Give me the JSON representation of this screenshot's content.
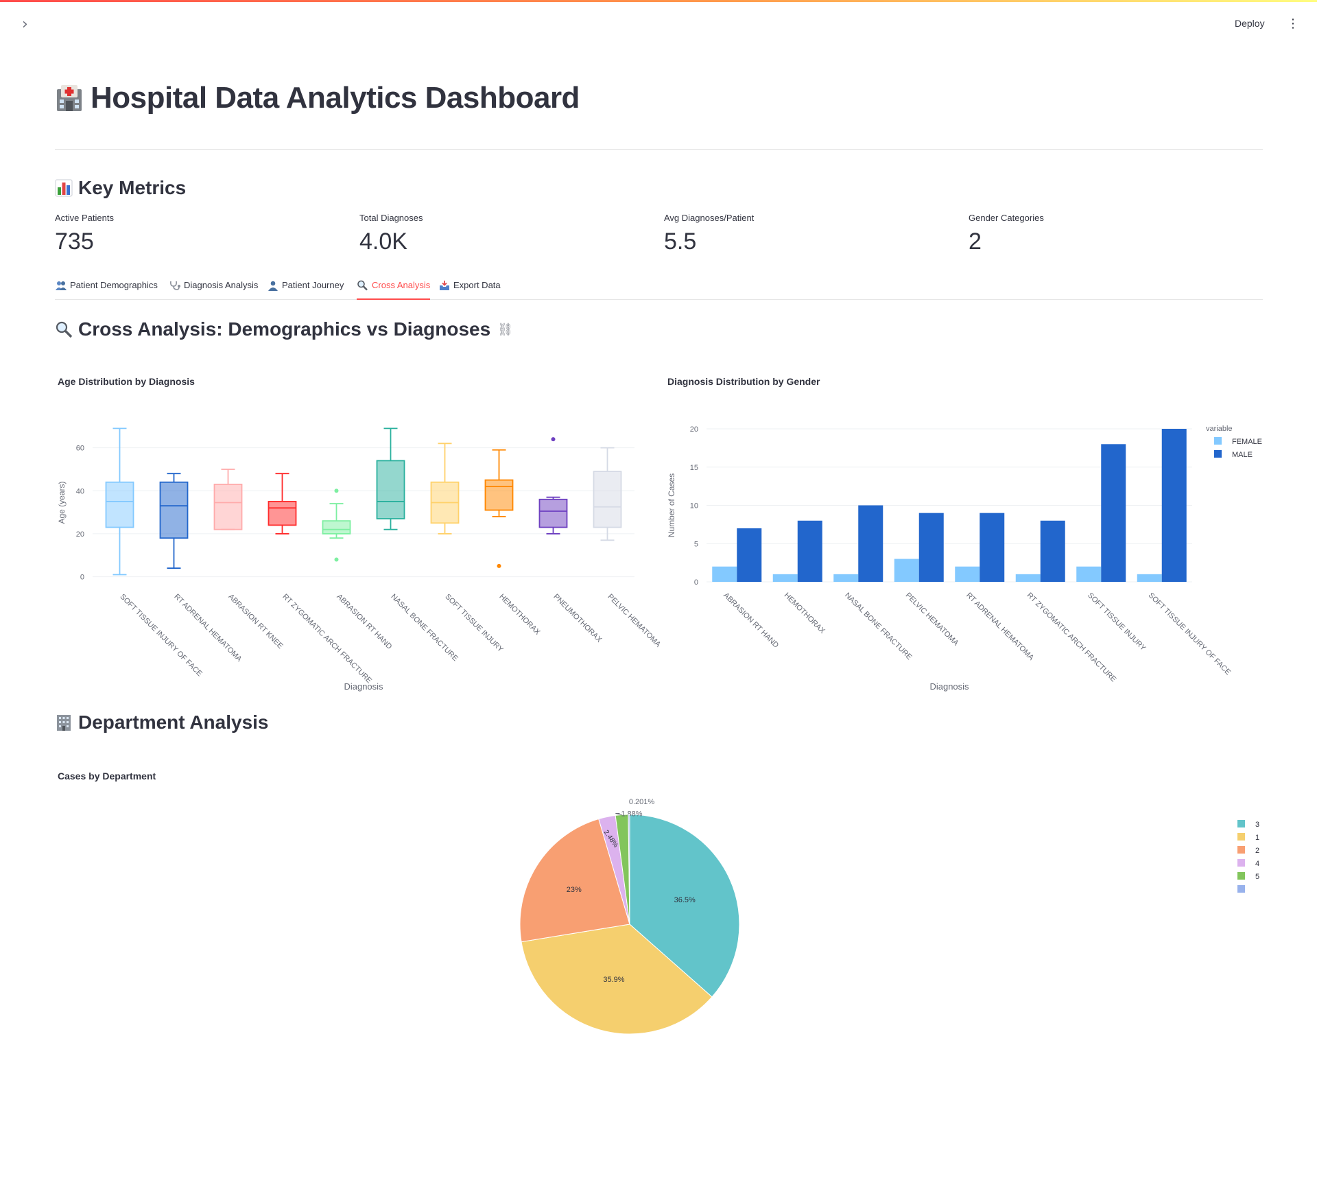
{
  "header": {
    "deploy_label": "Deploy",
    "menu_glyph": "⋮",
    "sidebar_toggle_glyph": "›"
  },
  "page": {
    "title": "Hospital Data Analytics Dashboard",
    "title_icon": "hospital-icon"
  },
  "key_metrics": {
    "heading": "Key Metrics",
    "icon": "bar-chart-icon",
    "items": [
      {
        "label": "Active Patients",
        "value": "735"
      },
      {
        "label": "Total Diagnoses",
        "value": "4.0K"
      },
      {
        "label": "Avg Diagnoses/Patient",
        "value": "5.5"
      },
      {
        "label": "Gender Categories",
        "value": "2"
      }
    ]
  },
  "tabs": [
    {
      "label": "Patient Demographics",
      "icon": "people-icon",
      "active": false
    },
    {
      "label": "Diagnosis Analysis",
      "icon": "stethoscope-icon",
      "active": false
    },
    {
      "label": "Patient Journey",
      "icon": "person-icon",
      "active": false
    },
    {
      "label": "Cross Analysis",
      "icon": "magnifier-icon",
      "active": true
    },
    {
      "label": "Export Data",
      "icon": "inbox-tray-icon",
      "active": false
    }
  ],
  "cross_analysis": {
    "heading": "Cross Analysis: Demographics vs Diagnoses",
    "icon": "magnifier-icon",
    "link_glyph": "⛓"
  },
  "department": {
    "heading": "Department Analysis",
    "icon": "office-building-icon"
  },
  "colors": {
    "accent": "#ff4b4b",
    "female": "#83c9ff",
    "male": "#2266cc"
  },
  "chart_data": [
    {
      "type": "box",
      "title": "Age Distribution by Diagnosis",
      "xlabel": "Diagnosis",
      "ylabel": "Age (years)",
      "ylim": [
        -3,
        72
      ],
      "yticks": [
        0,
        20,
        40,
        60
      ],
      "grid": true,
      "categories": [
        "SOFT TISSUE INJURY OF FACE",
        "RT ADRENAL HEMATOMA",
        "ABRASION RT KNEE",
        "RT ZYGOMATIC ARCH FRACTURE",
        "ABRASION RT HAND",
        "NASAL BONE FRACTURE",
        "SOFT TISSUE INJURY",
        "HEMOTHORAX",
        "PNEUMOTHORAX",
        "PELVIC HEMATOMA"
      ],
      "boxes": [
        {
          "min": 1,
          "q1": 23,
          "median": 35,
          "q3": 44,
          "max": 69,
          "outliers": [],
          "color": "#83c9ff"
        },
        {
          "min": 4,
          "q1": 18,
          "median": 33,
          "q3": 44,
          "max": 48,
          "outliers": [],
          "color": "#2266cc"
        },
        {
          "min": 22,
          "q1": 22,
          "median": 34.5,
          "q3": 43,
          "max": 50,
          "outliers": [],
          "color": "#ffabab"
        },
        {
          "min": 20,
          "q1": 24,
          "median": 32,
          "q3": 35,
          "max": 48,
          "outliers": [],
          "color": "#ff2b2b"
        },
        {
          "min": 18,
          "q1": 20,
          "median": 22,
          "q3": 26,
          "max": 34,
          "outliers": [
            8,
            40
          ],
          "color": "#7defa1"
        },
        {
          "min": 22,
          "q1": 27,
          "median": 35,
          "q3": 54,
          "max": 69,
          "outliers": [],
          "color": "#29b09d"
        },
        {
          "min": 20,
          "q1": 25,
          "median": 34.5,
          "q3": 44,
          "max": 62,
          "outliers": [],
          "color": "#ffd16a"
        },
        {
          "min": 28,
          "q1": 31,
          "median": 42,
          "q3": 45,
          "max": 59,
          "outliers": [
            5
          ],
          "color": "#ff8700"
        },
        {
          "min": 20,
          "q1": 23,
          "median": 30.5,
          "q3": 36,
          "max": 37,
          "outliers": [
            64
          ],
          "color": "#6d3fc0"
        },
        {
          "min": 17,
          "q1": 23,
          "median": 32.5,
          "q3": 49,
          "max": 60,
          "outliers": [],
          "color": "#d5dae5"
        }
      ]
    },
    {
      "type": "bar",
      "title": "Diagnosis Distribution by Gender",
      "xlabel": "Diagnosis",
      "ylabel": "Number of Cases",
      "ylim": [
        0,
        20
      ],
      "yticks": [
        0,
        5,
        10,
        15,
        20
      ],
      "legend_title": "variable",
      "legend_position": "top-right",
      "categories": [
        "ABRASION RT HAND",
        "HEMOTHORAX",
        "NASAL BONE FRACTURE",
        "PELVIC HEMATOMA",
        "RT ADRENAL HEMATOMA",
        "RT ZYGOMATIC ARCH FRACTURE",
        "SOFT TISSUE INJURY",
        "SOFT TISSUE INJURY OF FACE"
      ],
      "series": [
        {
          "name": "FEMALE",
          "color": "#83c9ff",
          "values": [
            2,
            1,
            1,
            3,
            2,
            1,
            2,
            1
          ]
        },
        {
          "name": "MALE",
          "color": "#2266cc",
          "values": [
            7,
            8,
            10,
            9,
            9,
            8,
            18,
            20
          ]
        }
      ]
    },
    {
      "type": "pie",
      "title": "Cases by Department",
      "legend_position": "top-right",
      "slices": [
        {
          "label": "3",
          "percent": 36.5,
          "text": "36.5%",
          "color": "#62c4ca"
        },
        {
          "label": "1",
          "percent": 35.9,
          "text": "35.9%",
          "color": "#f5cf6e"
        },
        {
          "label": "2",
          "percent": 23.0,
          "text": "23%",
          "color": "#f89f72"
        },
        {
          "label": "4",
          "percent": 2.48,
          "text": "2.48%",
          "color": "#dcb2ee"
        },
        {
          "label": "5",
          "percent": 1.88,
          "text": "1.88%",
          "color": "#82c55c"
        },
        {
          "label": "",
          "percent": 0.201,
          "text": "0.201%",
          "color": "#98b2ec"
        }
      ]
    }
  ]
}
